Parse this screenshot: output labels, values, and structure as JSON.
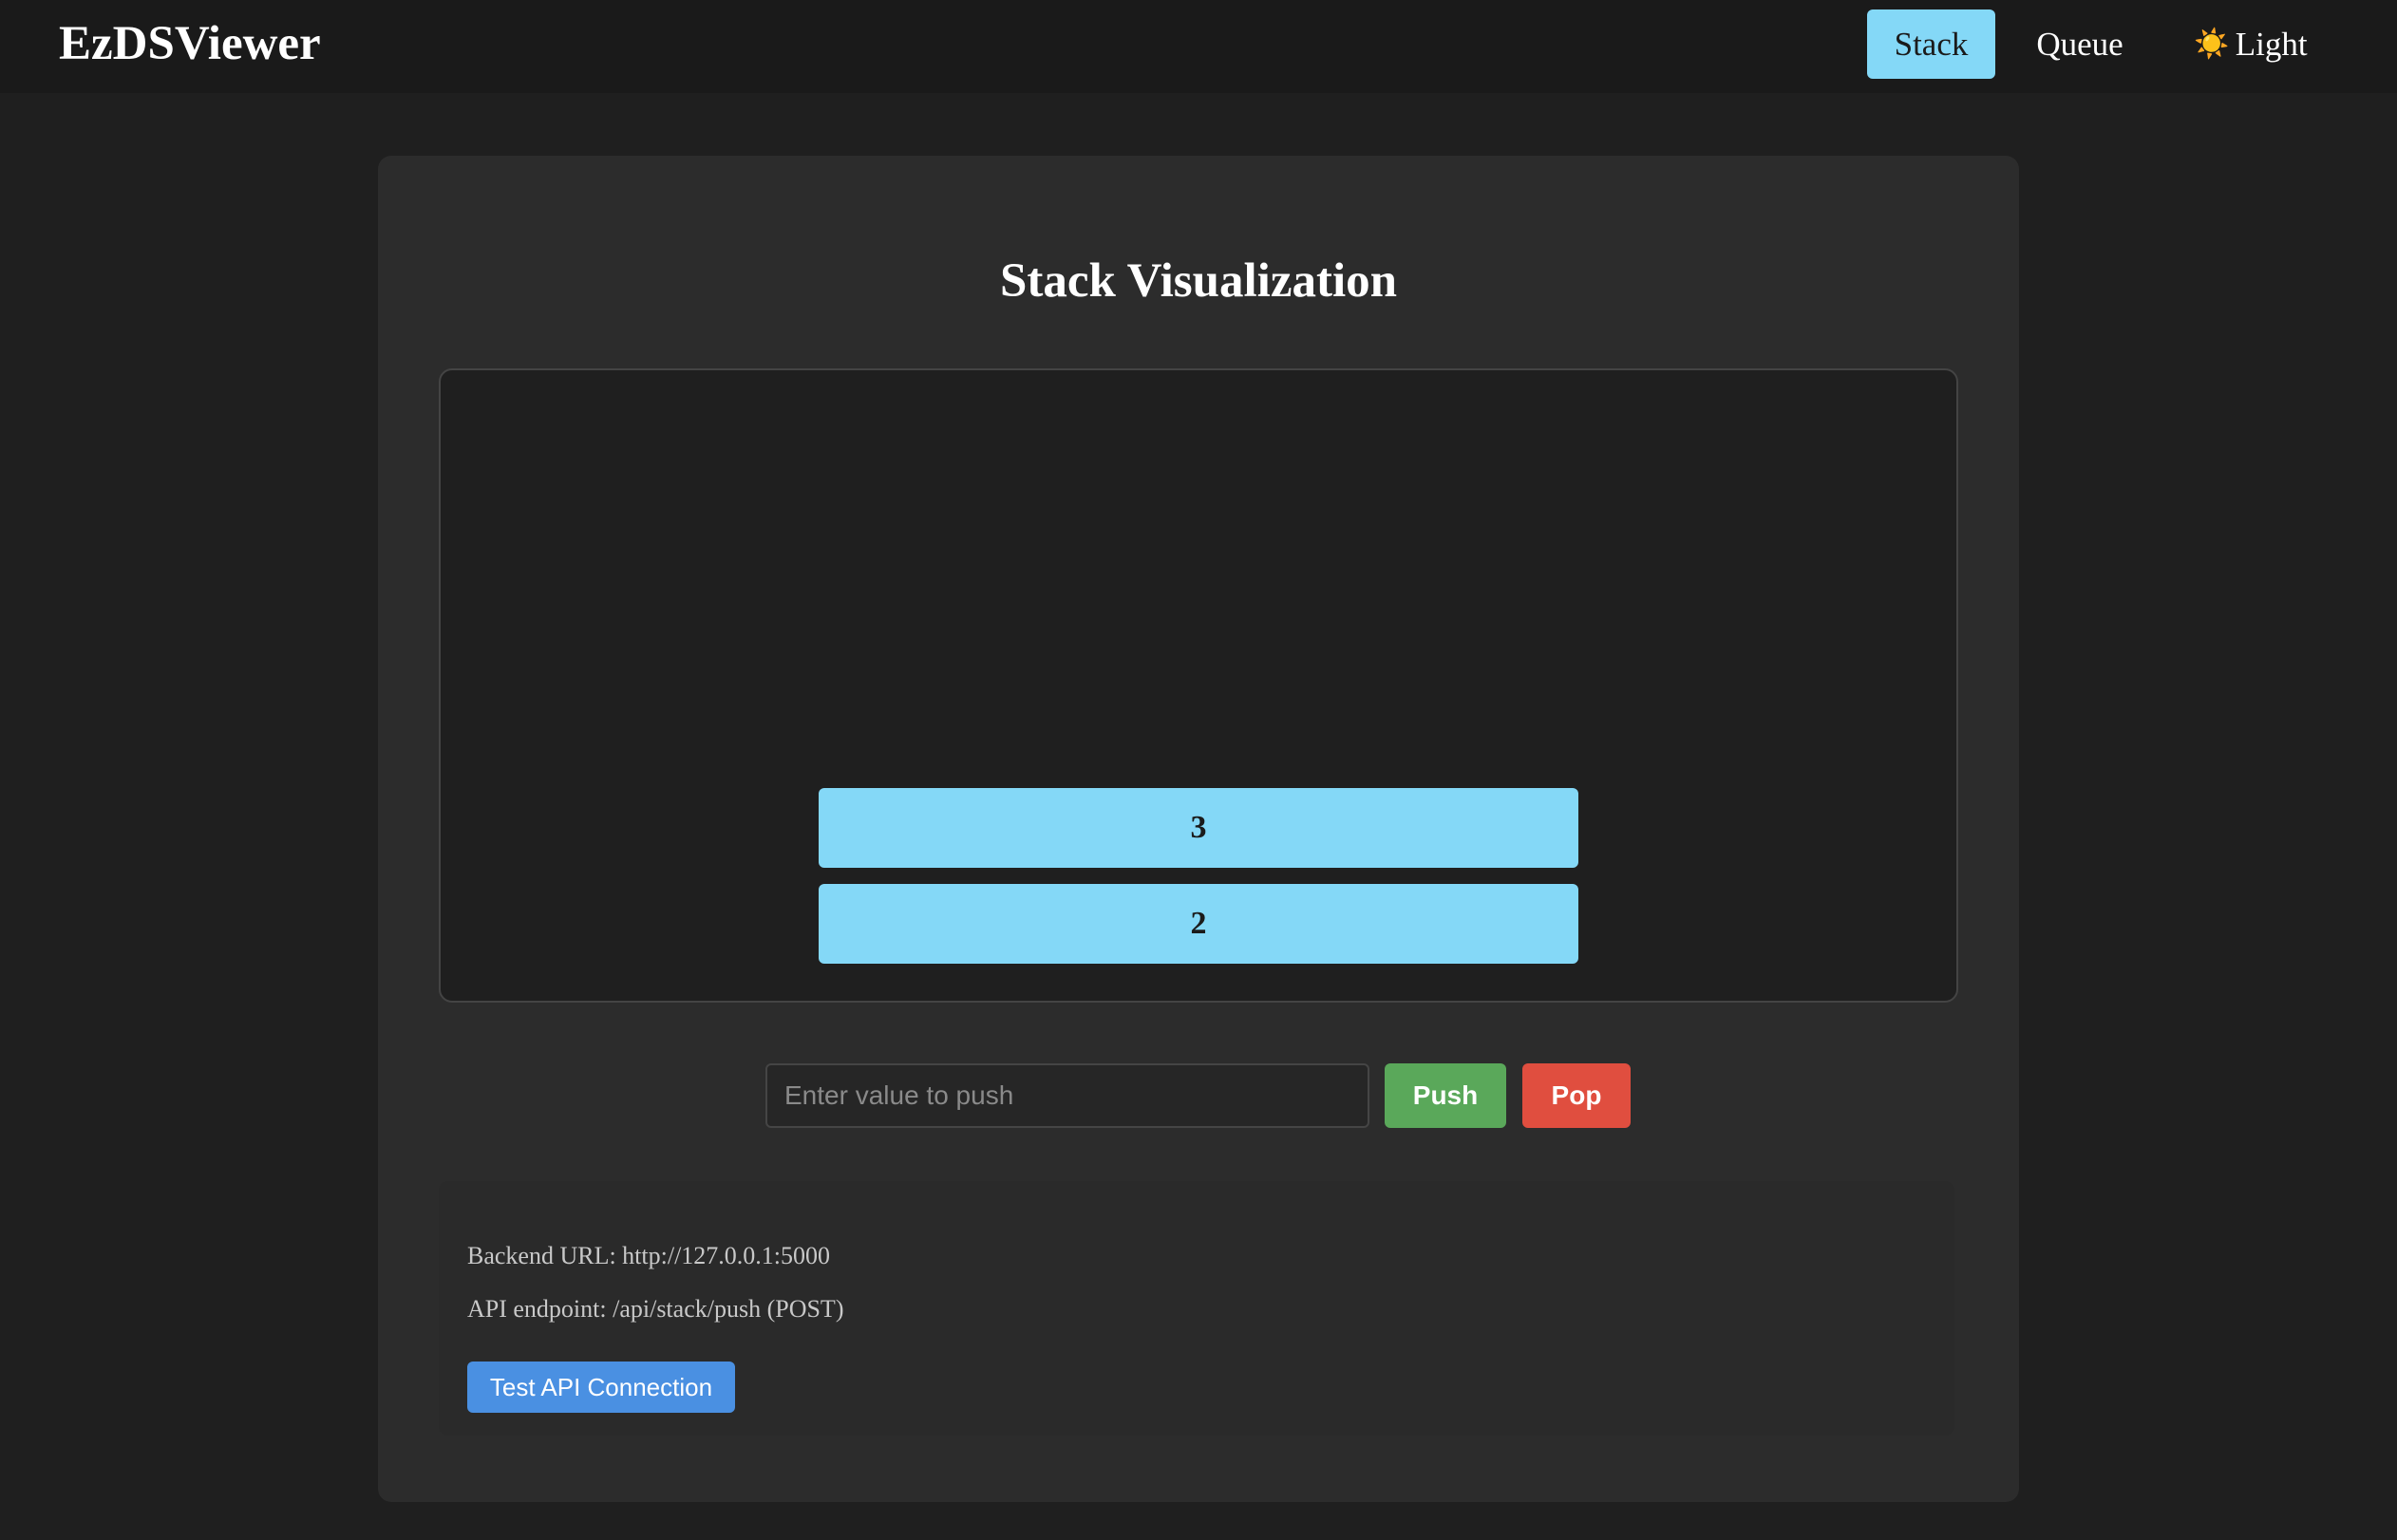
{
  "nav": {
    "brand": "EzDSViewer",
    "tabs": [
      {
        "label": "Stack",
        "active": true
      },
      {
        "label": "Queue",
        "active": false
      }
    ],
    "theme_toggle": {
      "icon": "sun-icon",
      "icon_glyph": "☀️",
      "label": "Light"
    }
  },
  "main": {
    "title": "Stack Visualization",
    "stack_items": [
      "3",
      "2"
    ],
    "input_placeholder": "Enter value to push",
    "push_label": "Push",
    "pop_label": "Pop"
  },
  "info": {
    "backend_url": "Backend URL: http://127.0.0.1:5000",
    "api_endpoint": "API endpoint: /api/stack/push (POST)",
    "test_button": "Test API Connection"
  },
  "colors": {
    "accent": "#84d8f7",
    "push": "#5aa85a",
    "pop": "#e04e3f",
    "test": "#4a90e2",
    "background": "#1f1f1f",
    "card": "#2c2c2c"
  }
}
